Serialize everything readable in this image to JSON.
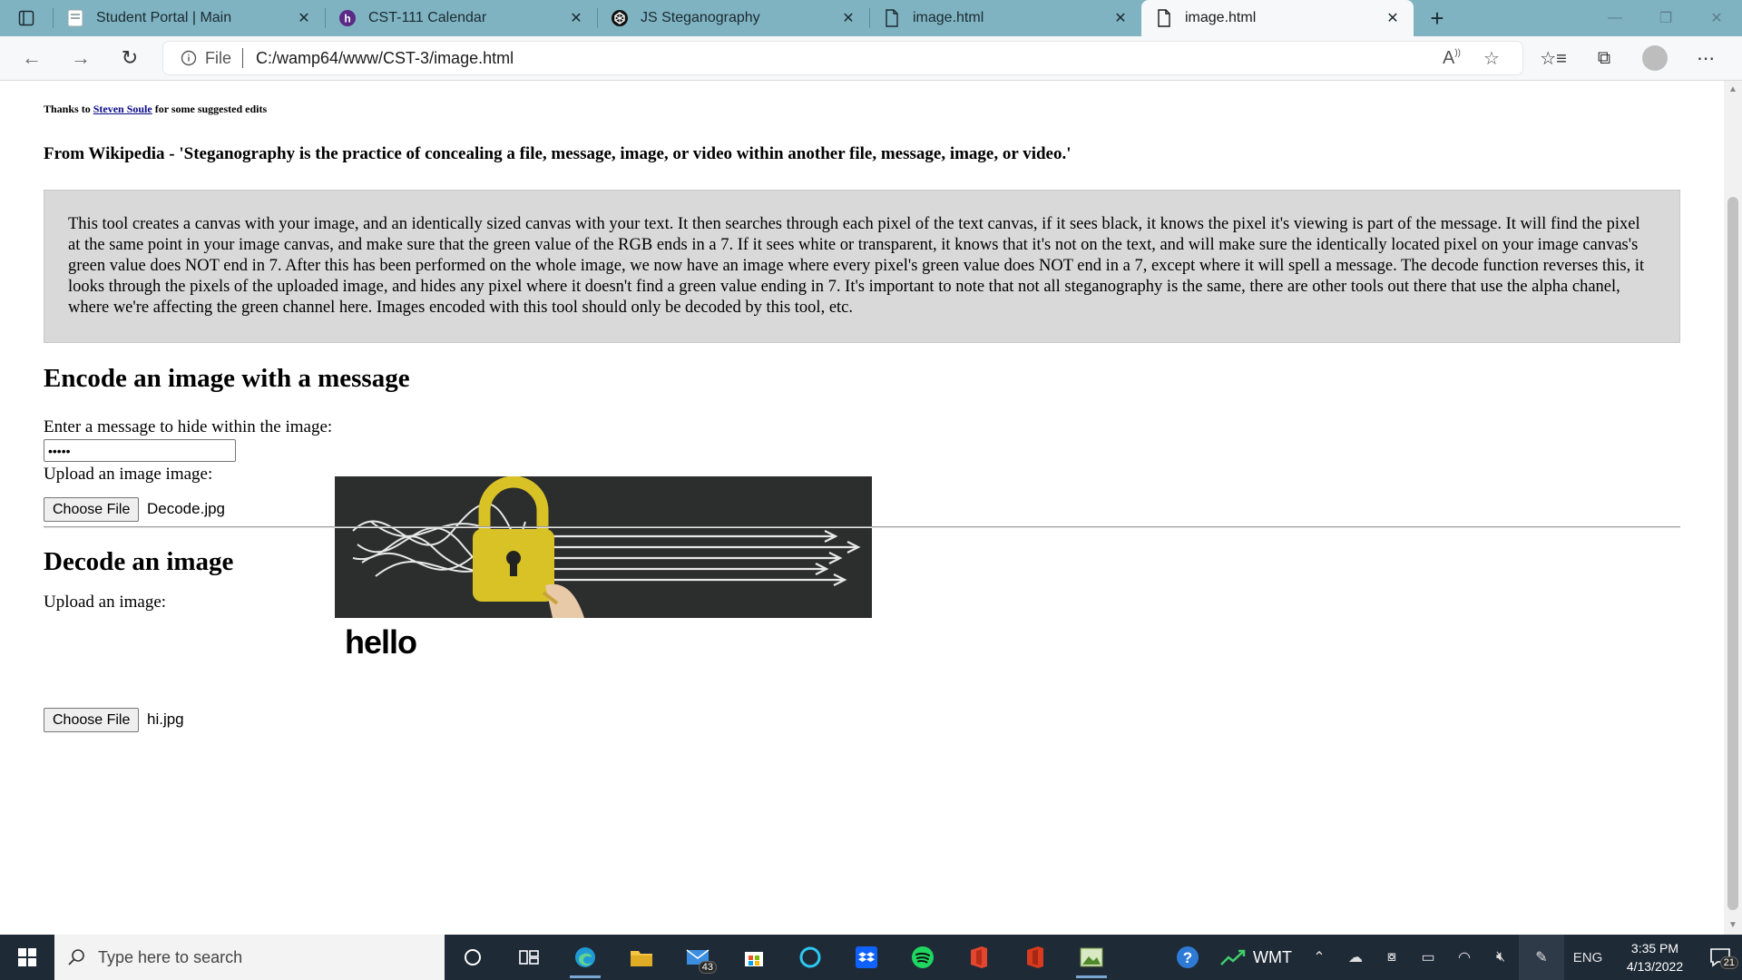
{
  "browser": {
    "tabs": [
      {
        "title": "Student Portal | Main",
        "icon": "document-icon",
        "active": false
      },
      {
        "title": "CST-111 Calendar",
        "icon": "h-logo-icon",
        "active": false
      },
      {
        "title": "JS Steganography",
        "icon": "codepen-icon",
        "active": false
      },
      {
        "title": "image.html",
        "icon": "file-icon",
        "active": false
      },
      {
        "title": "image.html",
        "icon": "file-icon",
        "active": true
      }
    ],
    "address": {
      "scheme_label": "File",
      "url": "C:/wamp64/www/CST-3/image.html"
    },
    "accent": "#7fb3c2"
  },
  "page": {
    "thanks_prefix": "Thanks to ",
    "thanks_link": "Steven Soule",
    "thanks_suffix": " for some suggested edits",
    "wiki_quote": "From Wikipedia - 'Steganography is the practice of concealing a file, message, image, or video within another file, message, image, or video.'",
    "description": "This tool creates a canvas with your image, and an identically sized canvas with your text. It then searches through each pixel of the text canvas, if it sees black, it knows the pixel it's viewing is part of the message. It will find the pixel at the same point in your image canvas, and make sure that the green value of the RGB ends in a 7. If it sees white or transparent, it knows that it's not on the text, and will make sure the identically located pixel on your image canvas's green value does NOT end in 7. After this has been performed on the whole image, we now have an image where every pixel's green value does NOT end in a 7, except where it will spell a message. The decode function reverses this, it looks through the pixels of the uploaded image, and hides any pixel where it doesn't find a green value ending in 7. It's important to note that not all steganography is the same, there are other tools out there that use the alpha chanel, where we're affecting the green channel here. Images encoded with this tool should only be decoded by this tool, etc.",
    "encode": {
      "heading": "Encode an image with a message",
      "message_label": "Enter a message to hide within the image:",
      "message_value": "•••••",
      "upload_label": "Upload an image image:",
      "button_label": "Choose File",
      "file_name": "Decode.jpg"
    },
    "decode": {
      "heading": "Decode an image",
      "upload_label": "Upload an image:",
      "decoded_text": "hello",
      "button_label": "Choose File",
      "file_name": "hi.jpg"
    }
  },
  "taskbar": {
    "search_placeholder": "Type here to search",
    "mail_badge": "43",
    "stock_ticker": "WMT",
    "language": "ENG",
    "time": "3:35 PM",
    "date": "4/13/2022",
    "notification_count": "21"
  }
}
